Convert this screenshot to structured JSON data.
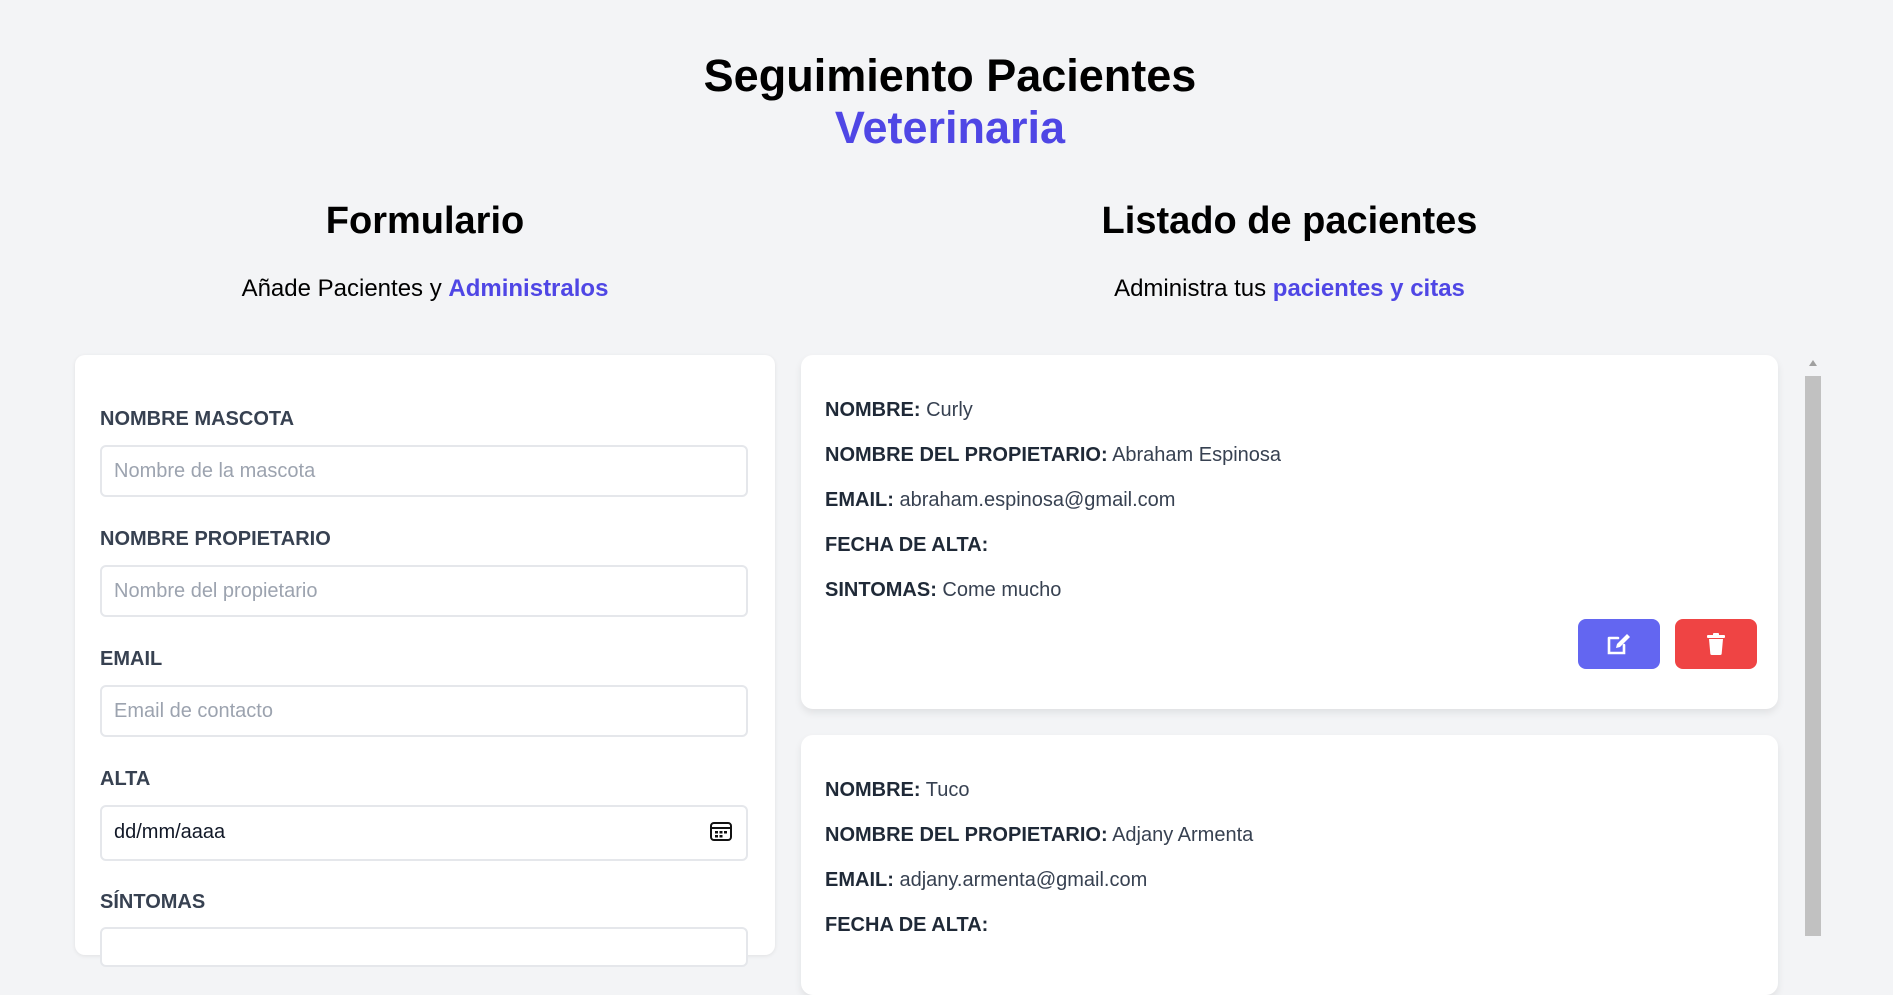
{
  "header": {
    "title": "Seguimiento Pacientes",
    "subtitle": "Veterinaria"
  },
  "form_section": {
    "title": "Formulario",
    "subtitle_prefix": "Añade Pacientes y ",
    "subtitle_accent": "Administralos"
  },
  "list_section": {
    "title": "Listado de pacientes",
    "subtitle_prefix": "Administra tus ",
    "subtitle_accent": "pacientes y citas"
  },
  "form": {
    "mascota": {
      "label": "NOMBRE MASCOTA",
      "placeholder": "Nombre de la mascota"
    },
    "propietario": {
      "label": "NOMBRE PROPIETARIO",
      "placeholder": "Nombre del propietario"
    },
    "email": {
      "label": "EMAIL",
      "placeholder": "Email de contacto"
    },
    "alta": {
      "label": "ALTA",
      "value": "dd/mm/aaaa"
    },
    "sintomas": {
      "label": "SÍNTOMAS"
    }
  },
  "patient_labels": {
    "nombre": "NOMBRE:",
    "propietario": "NOMBRE DEL PROPIETARIO:",
    "email": "EMAIL:",
    "fecha": "FECHA DE ALTA:",
    "sintomas": "SINTOMAS:"
  },
  "patients": [
    {
      "nombre": "Curly",
      "propietario": "Abraham Espinosa",
      "email": "abraham.espinosa@gmail.com",
      "fecha": "",
      "sintomas": "Come mucho"
    },
    {
      "nombre": "Tuco",
      "propietario": "Adjany Armenta",
      "email": "adjany.armenta@gmail.com",
      "fecha": ""
    }
  ],
  "colors": {
    "accent": "#4f46e5",
    "edit": "#6366f1",
    "delete": "#ef4444"
  },
  "icons": {
    "edit": "edit-icon",
    "delete": "trash-icon",
    "calendar": "calendar-icon"
  }
}
